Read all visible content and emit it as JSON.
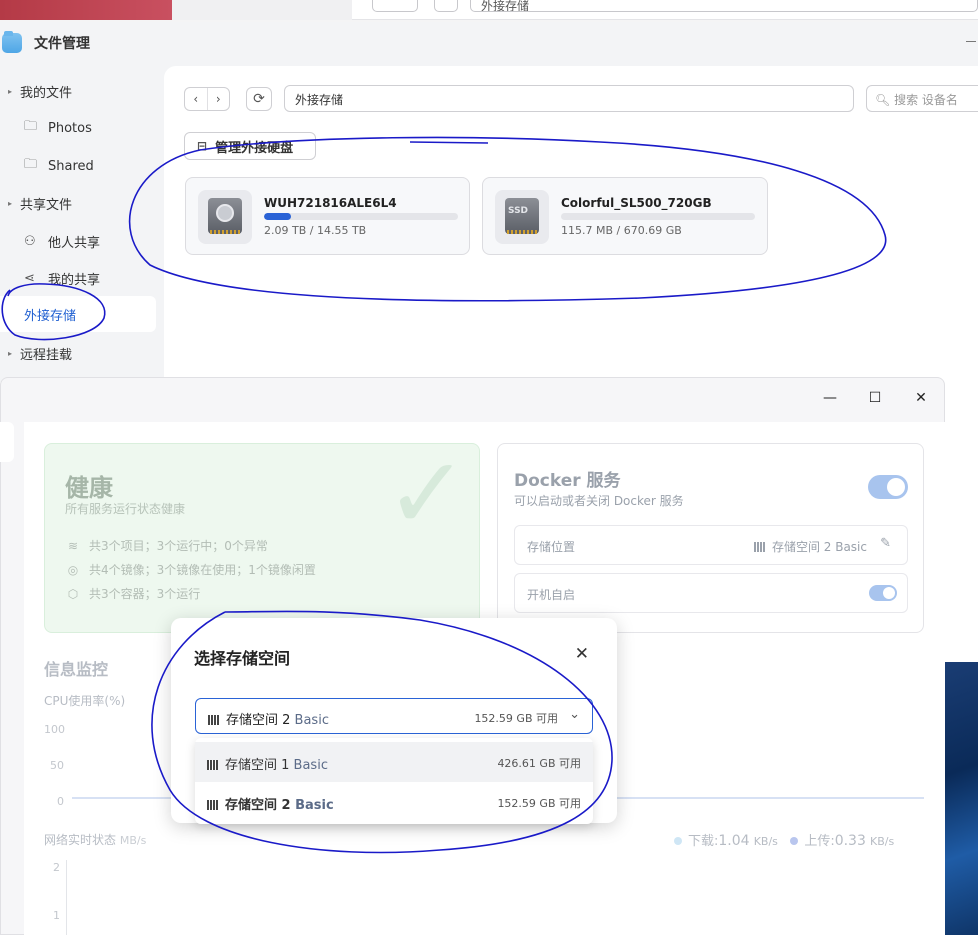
{
  "bg_window": {
    "path": "外接存储"
  },
  "file_manager": {
    "title": "文件管理",
    "sidebar": [
      {
        "label": "我的文件",
        "type": "group"
      },
      {
        "label": "Photos",
        "type": "folder"
      },
      {
        "label": "Shared",
        "type": "folder"
      },
      {
        "label": "共享文件",
        "type": "group"
      },
      {
        "label": "他人共享",
        "type": "people"
      },
      {
        "label": "我的共享",
        "type": "share"
      },
      {
        "label": "外接存储",
        "type": "active"
      },
      {
        "label": "远程挂载",
        "type": "group"
      }
    ],
    "nav": {
      "back": "‹",
      "forward": "›",
      "refresh": "⟳"
    },
    "path": "外接存储",
    "search_placeholder": "搜索 设备名",
    "manage_button": "管理外接硬盘",
    "drives": [
      {
        "name": "WUH721816ALE6L4",
        "usage": "2.09 TB / 14.55 TB",
        "used_fraction": 0.14,
        "kind": "hdd-icon"
      },
      {
        "name": "Colorful_SL500_720GB",
        "usage": "115.7 MB / 670.69 GB",
        "used_fraction": 0.0,
        "kind": "ssd-icon"
      }
    ]
  },
  "docker_window": {
    "controls": {
      "minimize": "—",
      "maximize": "☐",
      "close": "✕"
    },
    "health": {
      "title": "健康",
      "subtitle": "所有服务运行状态健康",
      "lines": [
        "共3个项目；3个运行中；0个异常",
        "共4个镜像；3个镜像在使用；1个镜像闲置",
        "共3个容器；3个运行"
      ]
    },
    "docker_service": {
      "title": "Docker 服务",
      "subtitle": "可以启动或者关闭 Docker 服务",
      "enabled": true,
      "storage_label": "存储位置",
      "storage_value": "存储空间 2 Basic",
      "autostart_label": "开机自启",
      "autostart": true
    },
    "monitor": {
      "title": "信息监控",
      "cpu_label": "CPU使用率(%)",
      "cpu_ticks": [
        "100",
        "50",
        "0"
      ],
      "net_label": "网络实时状态",
      "net_unit": "MB/s",
      "net_ticks": [
        "2",
        "1"
      ],
      "download_label": "下载:",
      "download_value": "1.04",
      "upload_label": "上传:",
      "upload_value": "0.33",
      "rate_unit": "KB/s",
      "download_color": "#cfe6f5",
      "upload_color": "#b9c6ee"
    }
  },
  "modal": {
    "title": "选择存储空间",
    "close": "✕",
    "selected": {
      "name": "存储空间 2",
      "type": "Basic",
      "free": "152.59 GB 可用"
    },
    "options": [
      {
        "name": "存储空间 1",
        "type": "Basic",
        "free": "426.61 GB 可用"
      },
      {
        "name": "存储空间 2",
        "type": "Basic",
        "free": "152.59 GB 可用"
      }
    ]
  }
}
